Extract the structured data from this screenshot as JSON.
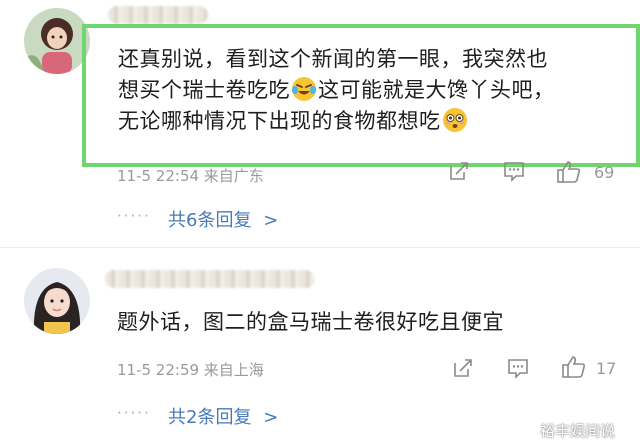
{
  "comments": [
    {
      "text_lines": [
        "还真别说，看到这个新闻的第一眼，我突然也",
        "想买个瑞士卷吃吃",
        "这可能就是大馋丫头吧，",
        "无论哪种情况下出现的食物都想吃"
      ],
      "meta": "11-5 22:54 来自广东",
      "likes": "69",
      "replies_label": "共6条回复",
      "replies_chevron": ">",
      "dots": "·····"
    },
    {
      "text_lines": [
        "题外话，图二的盒马瑞士卷很好吃且便宜"
      ],
      "meta": "11-5 22:59 来自上海",
      "likes": "17",
      "replies_label": "共2条回复",
      "replies_chevron": ">",
      "dots": "·····"
    }
  ],
  "icons": {
    "share": "share-icon",
    "comment": "comment-icon",
    "like": "thumbs-up-icon",
    "emoji_1": "laughing-crying-emoji",
    "emoji_2": "flushed-emoji"
  },
  "watermark": "裕丰娱间说",
  "colors": {
    "highlight_border": "#6fd66f",
    "link": "#4a79b8",
    "meta_gray": "#9a9a9a"
  }
}
